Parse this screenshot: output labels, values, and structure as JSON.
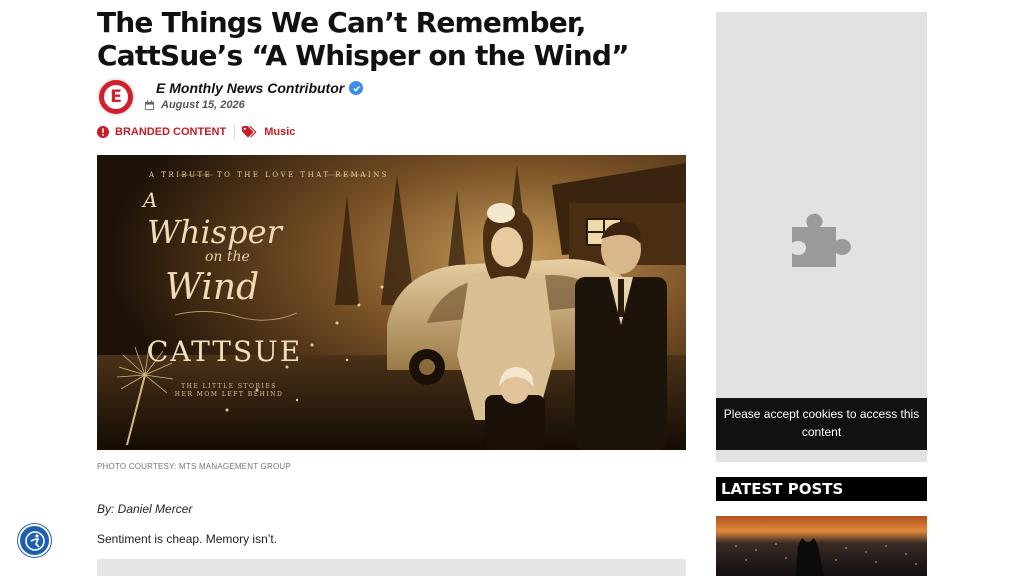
{
  "article": {
    "title_line1": "The Things We Can’t Remember,",
    "title_line2": "CattSue’s “A Whisper on the Wind”",
    "author": "E Monthly News Contributor",
    "avatar_letter": "E",
    "date": "August 15, 2026",
    "tags": [
      {
        "label": "BRANDED CONTENT",
        "icon": "info-circle-icon"
      },
      {
        "label": "Music",
        "icon": "tags-icon"
      }
    ],
    "photo_credit": "PHOTO COURTESY: MTS MANAGEMENT GROUP",
    "byline": "By: Daniel Mercer",
    "lede": "Sentiment is cheap. Memory isn’t."
  },
  "hero": {
    "top_caption": "A TRIBUTE TO THE LOVE THAT REMAINS",
    "title_a": "A",
    "title_whisper": "Whisper",
    "title_on_the": "on the",
    "title_wind": "Wind",
    "artist": "CATTSUE",
    "subtitle_line1": "THE LITTLE STORIES",
    "subtitle_line2": "HER MOM LEFT BEHIND"
  },
  "sidebar": {
    "cookie_notice": "Please accept cookies to access this content",
    "latest_posts_label": "LATEST POSTS"
  },
  "colors": {
    "brand_red": "#c31d26",
    "sepia": "#b88a4a",
    "verified_blue": "#3a8ee8",
    "accessibility_blue": "#1e5fb4"
  }
}
